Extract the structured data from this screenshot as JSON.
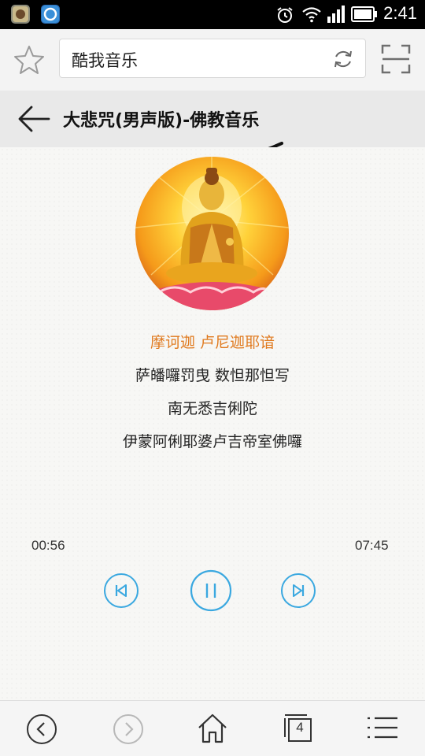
{
  "status_bar": {
    "time": "2:41",
    "icons": [
      "app-icon-1",
      "app-icon-2",
      "alarm-icon",
      "wifi-icon",
      "signal-icon",
      "battery-icon"
    ]
  },
  "browser": {
    "address_text": "酷我音乐",
    "icons": [
      "star-icon",
      "refresh-icon",
      "scan-icon"
    ]
  },
  "page": {
    "title": "大悲咒(男声版)-佛教音乐"
  },
  "lyrics": {
    "lines": [
      "摩诃迦 卢尼迦耶谙",
      "萨皤囉罚曳 数怛那怛写",
      "南无悉吉俐陀",
      "伊蒙阿俐耶婆卢吉帝室佛囉"
    ],
    "active_index": 0
  },
  "player": {
    "elapsed": "00:56",
    "duration": "07:45",
    "state": "playing",
    "accent_color": "#3aa8e0"
  },
  "bottom_nav": {
    "tabs_count": "4",
    "items": [
      "back-icon",
      "forward-icon",
      "home-icon",
      "tabs-icon",
      "menu-icon"
    ]
  }
}
